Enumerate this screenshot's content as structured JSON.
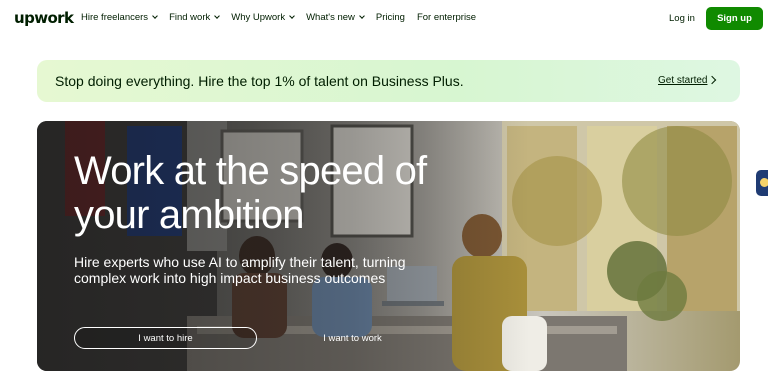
{
  "header": {
    "logo": "upwork",
    "nav": [
      {
        "label": "Hire freelancers",
        "dropdown": true
      },
      {
        "label": "Find work",
        "dropdown": true
      },
      {
        "label": "Why Upwork",
        "dropdown": true
      },
      {
        "label": "What's new",
        "dropdown": true
      },
      {
        "label": "Pricing",
        "dropdown": false
      },
      {
        "label": "For enterprise",
        "dropdown": false
      }
    ],
    "login": "Log in",
    "signup": "Sign up"
  },
  "banner": {
    "text": "Stop doing everything. Hire the top 1% of talent on Business Plus.",
    "link": "Get started"
  },
  "hero": {
    "title": "Work at the speed of your ambition",
    "subtitle": "Hire experts who use AI to amplify their talent, turning complex work into high impact business outcomes",
    "hire_button": "I want to hire",
    "work_button": "I want to work"
  },
  "colors": {
    "brand_green": "#108a00",
    "text_dark": "#001e00",
    "banner_bg": "#e6f8d2"
  }
}
